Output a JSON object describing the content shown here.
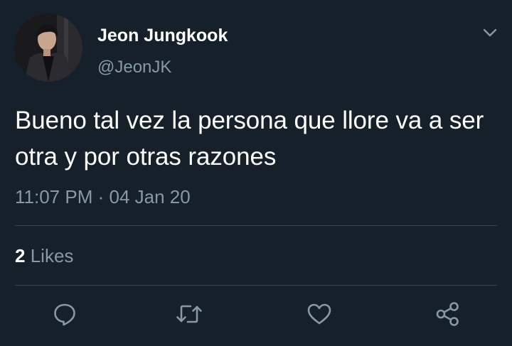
{
  "author": {
    "display_name": "Jeon Jungkook",
    "handle": "@JeonJK"
  },
  "tweet": {
    "text": "Bueno tal vez la persona que llore va a ser otra y por otras razones",
    "time": "11:07 PM",
    "separator": "·",
    "date": "04 Jan 20"
  },
  "stats": {
    "likes_count": "2",
    "likes_label": "Likes"
  },
  "actions": {
    "reply_icon": "reply-icon",
    "retweet_icon": "retweet-icon",
    "like_icon": "heart-icon",
    "share_icon": "share-icon"
  },
  "colors": {
    "background": "#15202b",
    "primary_text": "#ffffff",
    "secondary_text": "#8899a6",
    "divider": "#38444d"
  }
}
